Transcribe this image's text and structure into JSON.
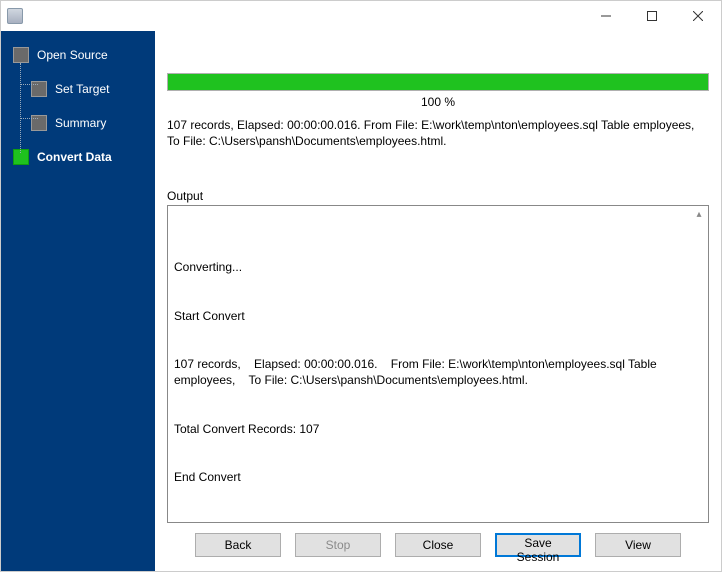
{
  "sidebar": {
    "steps": [
      {
        "label": "Open Source"
      },
      {
        "label": "Set Target"
      },
      {
        "label": "Summary"
      },
      {
        "label": "Convert Data"
      }
    ],
    "active_index": 3
  },
  "progress": {
    "percent_text": "100 %"
  },
  "status_text": "107 records,    Elapsed: 00:00:00.016.    From File: E:\\work\\temp\\nton\\employees.sql Table employees,    To File: C:\\Users\\pansh\\Documents\\employees.html.",
  "output": {
    "label": "Output",
    "lines": [
      "Converting...",
      "Start Convert",
      "107 records,    Elapsed: 00:00:00.016.    From File: E:\\work\\temp\\nton\\employees.sql Table employees,    To File: C:\\Users\\pansh\\Documents\\employees.html.",
      "Total Convert Records: 107",
      "End Convert"
    ]
  },
  "buttons": {
    "back": "Back",
    "stop": "Stop",
    "close": "Close",
    "save_session": "Save Session",
    "view": "View"
  }
}
